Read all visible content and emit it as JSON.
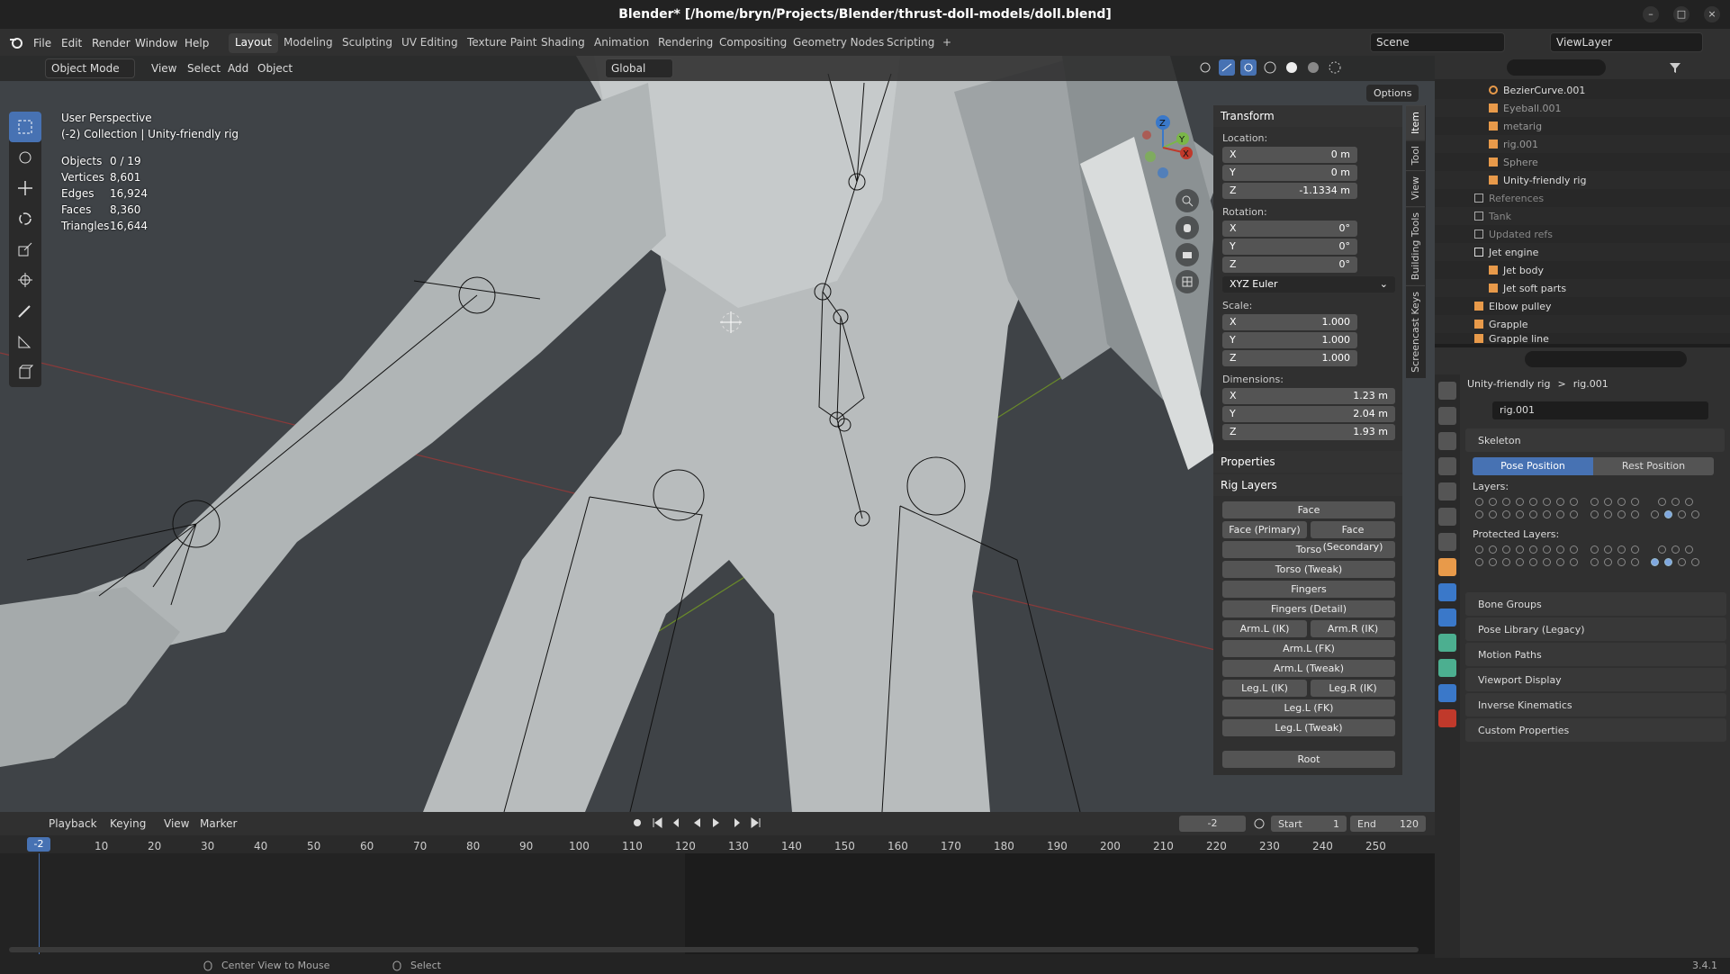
{
  "window": {
    "title": "Blender* [/home/bryn/Projects/Blender/thrust-doll-models/doll.blend]",
    "min": "–",
    "max": "□",
    "close": "×"
  },
  "menu": [
    "File",
    "Edit",
    "Render",
    "Window",
    "Help"
  ],
  "workspaces": [
    "Layout",
    "Modeling",
    "Sculpting",
    "UV Editing",
    "Texture Paint",
    "Shading",
    "Animation",
    "Rendering",
    "Compositing",
    "Geometry Nodes",
    "Scripting"
  ],
  "add_workspace": "+",
  "scene": {
    "label": "Scene",
    "viewlayer": "ViewLayer"
  },
  "viewport": {
    "mode": "Object Mode",
    "menus": [
      "View",
      "Select",
      "Add",
      "Object"
    ],
    "orientation": "Global",
    "options": "Options",
    "overlay_lines": [
      "User Perspective",
      "(-2) Collection | Unity-friendly rig"
    ],
    "stats": [
      [
        "Objects",
        "0 / 19"
      ],
      [
        "Vertices",
        "8,601"
      ],
      [
        "Edges",
        "16,924"
      ],
      [
        "Faces",
        "8,360"
      ],
      [
        "Triangles",
        "16,644"
      ]
    ],
    "gizmo": {
      "z": "Z",
      "y": "Y",
      "x": "X"
    }
  },
  "npanel": {
    "transform_title": "Transform",
    "location_label": "Location:",
    "location": [
      [
        "X",
        "0 m"
      ],
      [
        "Y",
        "0 m"
      ],
      [
        "Z",
        "-1.1334 m"
      ]
    ],
    "rotation_label": "Rotation:",
    "rotation": [
      [
        "X",
        "0°"
      ],
      [
        "Y",
        "0°"
      ],
      [
        "Z",
        "0°"
      ]
    ],
    "rotation_mode": "XYZ Euler",
    "scale_label": "Scale:",
    "scale": [
      [
        "X",
        "1.000"
      ],
      [
        "Y",
        "1.000"
      ],
      [
        "Z",
        "1.000"
      ]
    ],
    "dimensions_label": "Dimensions:",
    "dimensions": [
      [
        "X",
        "1.23 m"
      ],
      [
        "Y",
        "2.04 m"
      ],
      [
        "Z",
        "1.93 m"
      ]
    ],
    "properties_title": "Properties",
    "rig_layers_title": "Rig Layers",
    "rig": {
      "face": "Face",
      "face_primary": "Face (Primary)",
      "face_secondary": "Face (Secondary)",
      "torso": "Torso",
      "torso_tweak": "Torso (Tweak)",
      "fingers": "Fingers",
      "fingers_detail": "Fingers (Detail)",
      "arm_l_ik": "Arm.L (IK)",
      "arm_r_ik": "Arm.R (IK)",
      "arm_l_fk": "Arm.L (FK)",
      "arm_l_tweak": "Arm.L (Tweak)",
      "leg_l_ik": "Leg.L (IK)",
      "leg_r_ik": "Leg.R (IK)",
      "leg_l_fk": "Leg.L (FK)",
      "leg_l_tweak": "Leg.L (Tweak)",
      "root": "Root"
    },
    "tabs": [
      "Item",
      "Tool",
      "View",
      "Building Tools",
      "Screencast Keys"
    ]
  },
  "outliner": {
    "items": [
      "BezierCurve.001",
      "Eyeball.001",
      "metarig",
      "rig.001",
      "Sphere",
      "Unity-friendly rig",
      "References",
      "Tank",
      "Updated refs",
      "Jet engine",
      "Jet body",
      "Jet soft parts",
      "Elbow pulley",
      "Grapple",
      "Grapple line"
    ]
  },
  "properties": {
    "breadcrumb_object": "Unity-friendly rig",
    "breadcrumb_sep": ">",
    "breadcrumb_data": "rig.001",
    "datablock": "rig.001",
    "skeleton": "Skeleton",
    "pose_position": "Pose Position",
    "rest_position": "Rest Position",
    "layers": "Layers:",
    "protected_layers": "Protected Layers:",
    "panels": [
      "Bone Groups",
      "Pose Library (Legacy)",
      "Motion Paths",
      "Viewport Display",
      "Inverse Kinematics",
      "Custom Properties"
    ]
  },
  "timeline": {
    "menus": [
      "Playback",
      "Keying",
      "View",
      "Marker"
    ],
    "current_frame": "-2",
    "start_label": "Start",
    "start": "1",
    "end_label": "End",
    "end": "120",
    "ticks": [
      "10",
      "20",
      "30",
      "40",
      "50",
      "60",
      "70",
      "80",
      "90",
      "100",
      "110",
      "120",
      "130",
      "140",
      "150",
      "160",
      "170",
      "180",
      "190",
      "200",
      "210",
      "220",
      "230",
      "240",
      "250"
    ]
  },
  "status": {
    "hint1": "Center View to Mouse",
    "hint2": "Select",
    "version": "3.4.1"
  },
  "colors": {
    "accent": "#4772b3",
    "selected_text": "#ffffff",
    "x_axis": "#c0392b",
    "y_axis": "#7ab648",
    "z_axis": "#3a78c9"
  }
}
